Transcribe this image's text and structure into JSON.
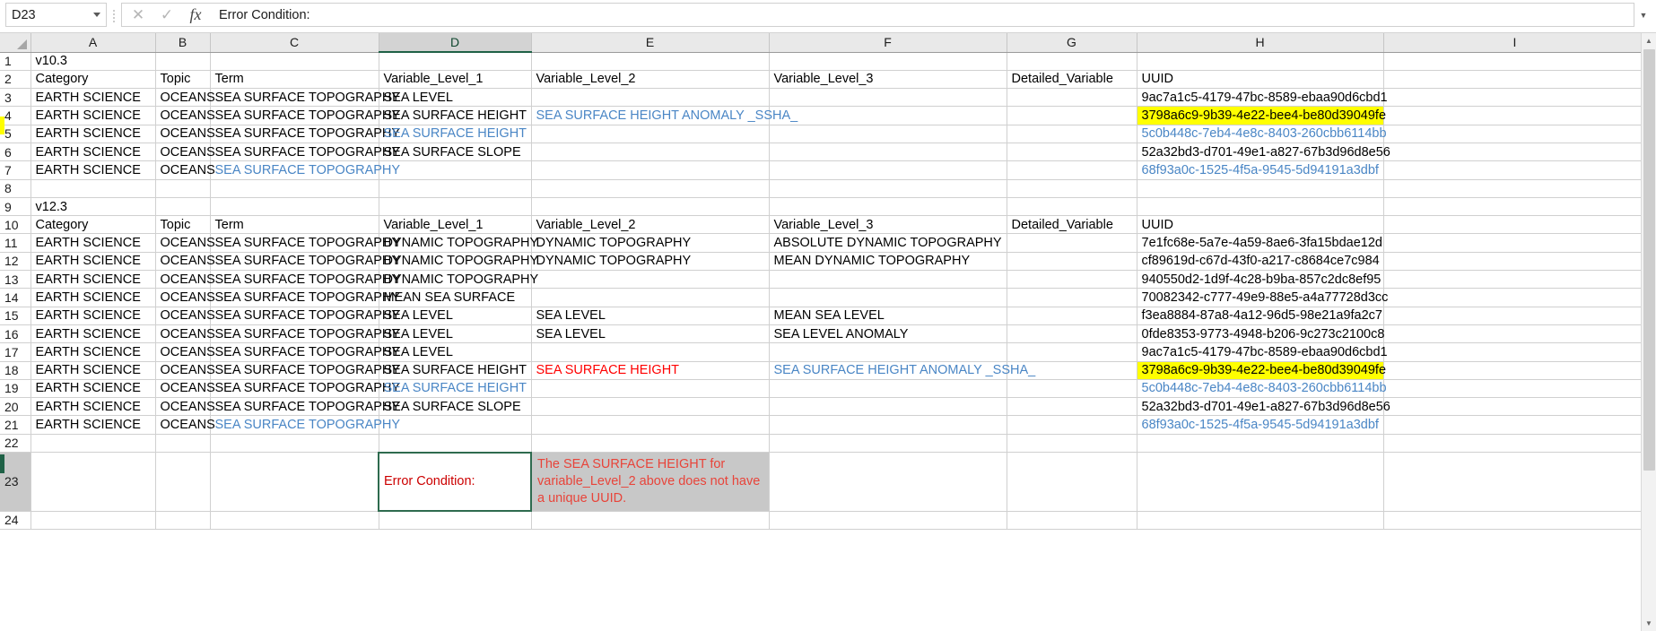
{
  "formula_bar": {
    "name_box_value": "D23",
    "cancel_icon": "close-icon",
    "confirm_icon": "check-icon",
    "function_icon": "fx-icon",
    "function_label": "fx",
    "formula_value": "Error Condition:"
  },
  "columns": [
    "A",
    "B",
    "C",
    "D",
    "E",
    "F",
    "G",
    "H",
    "I"
  ],
  "selected_column": "D",
  "selected_row": "23",
  "rows": [
    {
      "num": "1",
      "cells": [
        {
          "v": "v10.3",
          "cls": "bold"
        },
        {
          "v": ""
        },
        {
          "v": ""
        },
        {
          "v": ""
        },
        {
          "v": ""
        },
        {
          "v": ""
        },
        {
          "v": ""
        },
        {
          "v": ""
        },
        {
          "v": ""
        }
      ]
    },
    {
      "num": "2",
      "cells": [
        {
          "v": "Category"
        },
        {
          "v": "Topic"
        },
        {
          "v": "Term"
        },
        {
          "v": "Variable_Level_1"
        },
        {
          "v": "Variable_Level_2"
        },
        {
          "v": "Variable_Level_3"
        },
        {
          "v": "Detailed_Variable"
        },
        {
          "v": "UUID"
        },
        {
          "v": ""
        }
      ]
    },
    {
      "num": "3",
      "cells": [
        {
          "v": "EARTH SCIENCE"
        },
        {
          "v": "OCEANS"
        },
        {
          "v": "SEA SURFACE TOPOGRAPHY"
        },
        {
          "v": "SEA LEVEL"
        },
        {
          "v": ""
        },
        {
          "v": ""
        },
        {
          "v": ""
        },
        {
          "v": "9ac7a1c5-4179-47bc-8589-ebaa90d6cbd1"
        },
        {
          "v": ""
        }
      ]
    },
    {
      "num": "4",
      "cells": [
        {
          "v": "EARTH SCIENCE"
        },
        {
          "v": "OCEANS"
        },
        {
          "v": "SEA SURFACE TOPOGRAPHY"
        },
        {
          "v": "SEA SURFACE HEIGHT"
        },
        {
          "v": "SEA SURFACE HEIGHT ANOMALY _SSHA_",
          "cls": "blue"
        },
        {
          "v": ""
        },
        {
          "v": ""
        },
        {
          "v": "3798a6c9-9b39-4e22-bee4-be80d39049fe",
          "cls": "hl"
        },
        {
          "v": ""
        }
      ]
    },
    {
      "num": "5",
      "cells": [
        {
          "v": "EARTH SCIENCE"
        },
        {
          "v": "OCEANS"
        },
        {
          "v": "SEA SURFACE TOPOGRAPHY"
        },
        {
          "v": "SEA SURFACE HEIGHT",
          "cls": "blue"
        },
        {
          "v": ""
        },
        {
          "v": ""
        },
        {
          "v": ""
        },
        {
          "v": "5c0b448c-7eb4-4e8c-8403-260cbb6114bb",
          "cls": "blue"
        },
        {
          "v": ""
        }
      ]
    },
    {
      "num": "6",
      "cells": [
        {
          "v": "EARTH SCIENCE"
        },
        {
          "v": "OCEANS"
        },
        {
          "v": "SEA SURFACE TOPOGRAPHY"
        },
        {
          "v": "SEA SURFACE SLOPE"
        },
        {
          "v": ""
        },
        {
          "v": ""
        },
        {
          "v": ""
        },
        {
          "v": "52a32bd3-d701-49e1-a827-67b3d96d8e56"
        },
        {
          "v": ""
        }
      ]
    },
    {
      "num": "7",
      "cells": [
        {
          "v": "EARTH SCIENCE"
        },
        {
          "v": "OCEANS"
        },
        {
          "v": "SEA SURFACE TOPOGRAPHY",
          "cls": "blue"
        },
        {
          "v": ""
        },
        {
          "v": ""
        },
        {
          "v": ""
        },
        {
          "v": ""
        },
        {
          "v": "68f93a0c-1525-4f5a-9545-5d94191a3dbf",
          "cls": "blue"
        },
        {
          "v": ""
        }
      ]
    },
    {
      "num": "8",
      "cells": [
        {
          "v": ""
        },
        {
          "v": ""
        },
        {
          "v": ""
        },
        {
          "v": ""
        },
        {
          "v": ""
        },
        {
          "v": ""
        },
        {
          "v": ""
        },
        {
          "v": ""
        },
        {
          "v": ""
        }
      ]
    },
    {
      "num": "9",
      "cells": [
        {
          "v": "v12.3",
          "cls": "bold"
        },
        {
          "v": ""
        },
        {
          "v": ""
        },
        {
          "v": ""
        },
        {
          "v": ""
        },
        {
          "v": ""
        },
        {
          "v": ""
        },
        {
          "v": ""
        },
        {
          "v": ""
        }
      ]
    },
    {
      "num": "10",
      "cells": [
        {
          "v": "Category"
        },
        {
          "v": "Topic"
        },
        {
          "v": "Term"
        },
        {
          "v": "Variable_Level_1"
        },
        {
          "v": "Variable_Level_2"
        },
        {
          "v": "Variable_Level_3"
        },
        {
          "v": "Detailed_Variable"
        },
        {
          "v": "UUID"
        },
        {
          "v": ""
        }
      ]
    },
    {
      "num": "11",
      "cells": [
        {
          "v": "EARTH SCIENCE"
        },
        {
          "v": "OCEANS"
        },
        {
          "v": "SEA SURFACE TOPOGRAPHY"
        },
        {
          "v": "DYNAMIC TOPOGRAPHY"
        },
        {
          "v": "DYNAMIC TOPOGRAPHY"
        },
        {
          "v": "ABSOLUTE DYNAMIC TOPOGRAPHY"
        },
        {
          "v": ""
        },
        {
          "v": "7e1fc68e-5a7e-4a59-8ae6-3fa15bdae12d"
        },
        {
          "v": ""
        }
      ]
    },
    {
      "num": "12",
      "cells": [
        {
          "v": "EARTH SCIENCE"
        },
        {
          "v": "OCEANS"
        },
        {
          "v": "SEA SURFACE TOPOGRAPHY"
        },
        {
          "v": "DYNAMIC TOPOGRAPHY"
        },
        {
          "v": "DYNAMIC TOPOGRAPHY"
        },
        {
          "v": "MEAN DYNAMIC TOPOGRAPHY"
        },
        {
          "v": ""
        },
        {
          "v": "cf89619d-c67d-43f0-a217-c8684ce7c984"
        },
        {
          "v": ""
        }
      ]
    },
    {
      "num": "13",
      "cells": [
        {
          "v": "EARTH SCIENCE"
        },
        {
          "v": "OCEANS"
        },
        {
          "v": "SEA SURFACE TOPOGRAPHY"
        },
        {
          "v": "DYNAMIC TOPOGRAPHY"
        },
        {
          "v": ""
        },
        {
          "v": ""
        },
        {
          "v": ""
        },
        {
          "v": "940550d2-1d9f-4c28-b9ba-857c2dc8ef95"
        },
        {
          "v": ""
        }
      ]
    },
    {
      "num": "14",
      "cells": [
        {
          "v": "EARTH SCIENCE"
        },
        {
          "v": "OCEANS"
        },
        {
          "v": "SEA SURFACE TOPOGRAPHY"
        },
        {
          "v": "MEAN SEA SURFACE"
        },
        {
          "v": ""
        },
        {
          "v": ""
        },
        {
          "v": ""
        },
        {
          "v": "70082342-c777-49e9-88e5-a4a77728d3cc"
        },
        {
          "v": ""
        }
      ]
    },
    {
      "num": "15",
      "cells": [
        {
          "v": "EARTH SCIENCE"
        },
        {
          "v": "OCEANS"
        },
        {
          "v": "SEA SURFACE TOPOGRAPHY"
        },
        {
          "v": "SEA LEVEL"
        },
        {
          "v": "SEA LEVEL"
        },
        {
          "v": "MEAN SEA LEVEL"
        },
        {
          "v": ""
        },
        {
          "v": "f3ea8884-87a8-4a12-96d5-98e21a9fa2c7"
        },
        {
          "v": ""
        }
      ]
    },
    {
      "num": "16",
      "cells": [
        {
          "v": "EARTH SCIENCE"
        },
        {
          "v": "OCEANS"
        },
        {
          "v": "SEA SURFACE TOPOGRAPHY"
        },
        {
          "v": "SEA LEVEL"
        },
        {
          "v": "SEA LEVEL"
        },
        {
          "v": "SEA LEVEL ANOMALY"
        },
        {
          "v": ""
        },
        {
          "v": "0fde8353-9773-4948-b206-9c273c2100c8"
        },
        {
          "v": ""
        }
      ]
    },
    {
      "num": "17",
      "cells": [
        {
          "v": "EARTH SCIENCE"
        },
        {
          "v": "OCEANS"
        },
        {
          "v": "SEA SURFACE TOPOGRAPHY"
        },
        {
          "v": "SEA LEVEL"
        },
        {
          "v": ""
        },
        {
          "v": ""
        },
        {
          "v": ""
        },
        {
          "v": "9ac7a1c5-4179-47bc-8589-ebaa90d6cbd1"
        },
        {
          "v": ""
        }
      ]
    },
    {
      "num": "18",
      "cells": [
        {
          "v": "EARTH SCIENCE"
        },
        {
          "v": "OCEANS"
        },
        {
          "v": "SEA SURFACE TOPOGRAPHY"
        },
        {
          "v": "SEA SURFACE HEIGHT"
        },
        {
          "v": "SEA SURFACE HEIGHT",
          "cls": "red"
        },
        {
          "v": "SEA SURFACE HEIGHT ANOMALY _SSHA_",
          "cls": "blue"
        },
        {
          "v": ""
        },
        {
          "v": "3798a6c9-9b39-4e22-bee4-be80d39049fe",
          "cls": "hl"
        },
        {
          "v": ""
        }
      ]
    },
    {
      "num": "19",
      "cells": [
        {
          "v": "EARTH SCIENCE"
        },
        {
          "v": "OCEANS"
        },
        {
          "v": "SEA SURFACE TOPOGRAPHY"
        },
        {
          "v": "SEA SURFACE HEIGHT",
          "cls": "blue"
        },
        {
          "v": ""
        },
        {
          "v": ""
        },
        {
          "v": ""
        },
        {
          "v": "5c0b448c-7eb4-4e8c-8403-260cbb6114bb",
          "cls": "blue"
        },
        {
          "v": ""
        }
      ]
    },
    {
      "num": "20",
      "cells": [
        {
          "v": "EARTH SCIENCE"
        },
        {
          "v": "OCEANS"
        },
        {
          "v": "SEA SURFACE TOPOGRAPHY"
        },
        {
          "v": "SEA SURFACE SLOPE"
        },
        {
          "v": ""
        },
        {
          "v": ""
        },
        {
          "v": ""
        },
        {
          "v": "52a32bd3-d701-49e1-a827-67b3d96d8e56"
        },
        {
          "v": ""
        }
      ]
    },
    {
      "num": "21",
      "cells": [
        {
          "v": "EARTH SCIENCE"
        },
        {
          "v": "OCEANS"
        },
        {
          "v": "SEA SURFACE TOPOGRAPHY",
          "cls": "blue"
        },
        {
          "v": ""
        },
        {
          "v": ""
        },
        {
          "v": ""
        },
        {
          "v": ""
        },
        {
          "v": "68f93a0c-1525-4f5a-9545-5d94191a3dbf",
          "cls": "blue"
        },
        {
          "v": ""
        }
      ]
    },
    {
      "num": "22",
      "cells": [
        {
          "v": ""
        },
        {
          "v": ""
        },
        {
          "v": ""
        },
        {
          "v": ""
        },
        {
          "v": ""
        },
        {
          "v": ""
        },
        {
          "v": ""
        },
        {
          "v": ""
        },
        {
          "v": ""
        }
      ]
    },
    {
      "num": "24",
      "cells": [
        {
          "v": ""
        },
        {
          "v": ""
        },
        {
          "v": ""
        },
        {
          "v": ""
        },
        {
          "v": ""
        },
        {
          "v": ""
        },
        {
          "v": ""
        },
        {
          "v": ""
        },
        {
          "v": ""
        }
      ]
    }
  ],
  "error_row": {
    "num": "23",
    "label": "Error Condition:",
    "message": "The SEA SURFACE HEIGHT for variable_Level_2 above does not have a unique UUID."
  },
  "colors": {
    "highlight": "#ffff00",
    "hyperlink": "#4a86c5",
    "error_text": "#ff0000",
    "selection_border": "#2e6b4f"
  }
}
